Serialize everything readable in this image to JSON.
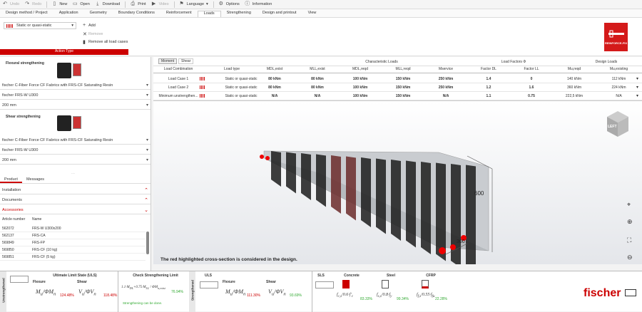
{
  "toolbar": {
    "undo": "Undo",
    "redo": "Redo",
    "new": "New",
    "open": "Open",
    "download": "Download",
    "print": "Print",
    "video": "Video",
    "language": "Language",
    "options": "Options",
    "information": "Information"
  },
  "menu": [
    "Design method / Project",
    "Application",
    "Geometry",
    "Boundary Conditions",
    "Reinforcement",
    "Loads",
    "Strengthening",
    "Design and printout",
    "View"
  ],
  "ribbon": {
    "action_type_value": "Static or quasi-static",
    "add": "Add",
    "remove": "Remove",
    "remove_all": "Remove all load cases",
    "action_type_label": "Action Type",
    "logo_text": "REINFORCE-FIX"
  },
  "left": {
    "flexural_title": "Flexural strengthening",
    "flexural_product": "fischer C-Fiber Force CF Fabrics with FRS-CF Saturating Resin",
    "flexural_type": "fischer FRS-W U300",
    "flexural_width": "200 mm",
    "shear_title": "Shear strengthening",
    "shear_product": "fischer C-Fiber Force CF Fabrics with FRS-CF Saturating Resin",
    "shear_type": "fischer FRS-W U300",
    "shear_width": "200 mm",
    "tab_product": "Product",
    "tab_messages": "Messages",
    "installation": "Installation",
    "documents": "Documents",
    "accessories": "Accessories",
    "col_article": "Article number",
    "col_name": "Name",
    "articles": [
      {
        "num": "562072",
        "name": "FRS-W U300x200"
      },
      {
        "num": "562137",
        "name": "FRS-CA"
      },
      {
        "num": "569849",
        "name": "FRS-FP"
      },
      {
        "num": "569850",
        "name": "FRS-CF (10 kg)"
      },
      {
        "num": "569851",
        "name": "FRS-CF (5 kg)"
      }
    ]
  },
  "loads_table": {
    "tab_moment": "Moment",
    "tab_shear": "Shear",
    "hdr_char": "Characteristic Loads",
    "hdr_factors": "Load Factors Φ",
    "hdr_design": "Design Loads",
    "col_combo": "Load Combination",
    "col_type": "Load type",
    "col_mdl_exist": "MDL,exist",
    "col_mll_exist": "MLL,exist",
    "col_mdl_reqd": "MDL,reqd",
    "col_mll_reqd": "MLL,reqd",
    "col_mservice": "Mservice",
    "col_fdl": "Factor DL",
    "col_fll": "Factor LL",
    "col_mu_reqd": "Mu,reqd",
    "col_mu_exist": "Mu,existing",
    "rows": [
      {
        "combo": "Load Case 1",
        "type": "Static or quasi-static",
        "mdle": "80 kNm",
        "mlle": "80 kNm",
        "mdlr": "100 kNm",
        "mllr": "150 kNm",
        "ms": "250 kNm",
        "fdl": "1.4",
        "fll": "0",
        "mur": "140 kNm",
        "mue": "112 kNm"
      },
      {
        "combo": "Load Case 2",
        "type": "Static or quasi-static",
        "mdle": "80 kNm",
        "mlle": "80 kNm",
        "mdlr": "100 kNm",
        "mllr": "150 kNm",
        "ms": "250 kNm",
        "fdl": "1.2",
        "fll": "1.6",
        "mur": "360 kNm",
        "mue": "224 kNm"
      },
      {
        "combo": "Minimum unstrengthen...",
        "type": "Static or quasi-static",
        "mdle": "N/A",
        "mlle": "N/A",
        "mdlr": "100 kNm",
        "mllr": "150 kNm",
        "ms": "N/A",
        "fdl": "1.1",
        "fll": "0.75",
        "mur": "222,5 kNm",
        "mue": "N/A"
      }
    ]
  },
  "viewer": {
    "dim_600": "600",
    "dim_300": "300",
    "cube_label": "LEFT",
    "note": "The red highlighted cross-section is considered in the design."
  },
  "bottom": {
    "unstrengthened": "Unstrengthened",
    "strengthened": "Strengthened",
    "uls_title": "Ultimate Limit State (ULS)",
    "check_title": "Check Strengthening Limit",
    "uls": "ULS",
    "sls": "SLS",
    "flexure": "Flexure",
    "shear": "Shear",
    "concrete": "Concrete",
    "steel": "Steel",
    "cfrp": "CFRP",
    "u_flex_pct": "124.48%",
    "u_shear_pct": "118.48%",
    "check_pct": "76.94%",
    "check_msg": "Strengthening can be done.",
    "s_flex_pct": "111.30%",
    "s_shear_pct": "93.69%",
    "conc_pct": "83.33%",
    "steel_pct": "99.34%",
    "cfrp_pct": "22.28%",
    "brand": "fischer"
  },
  "colors": {
    "accent": "#cc0000",
    "ok": "#33aa33"
  }
}
